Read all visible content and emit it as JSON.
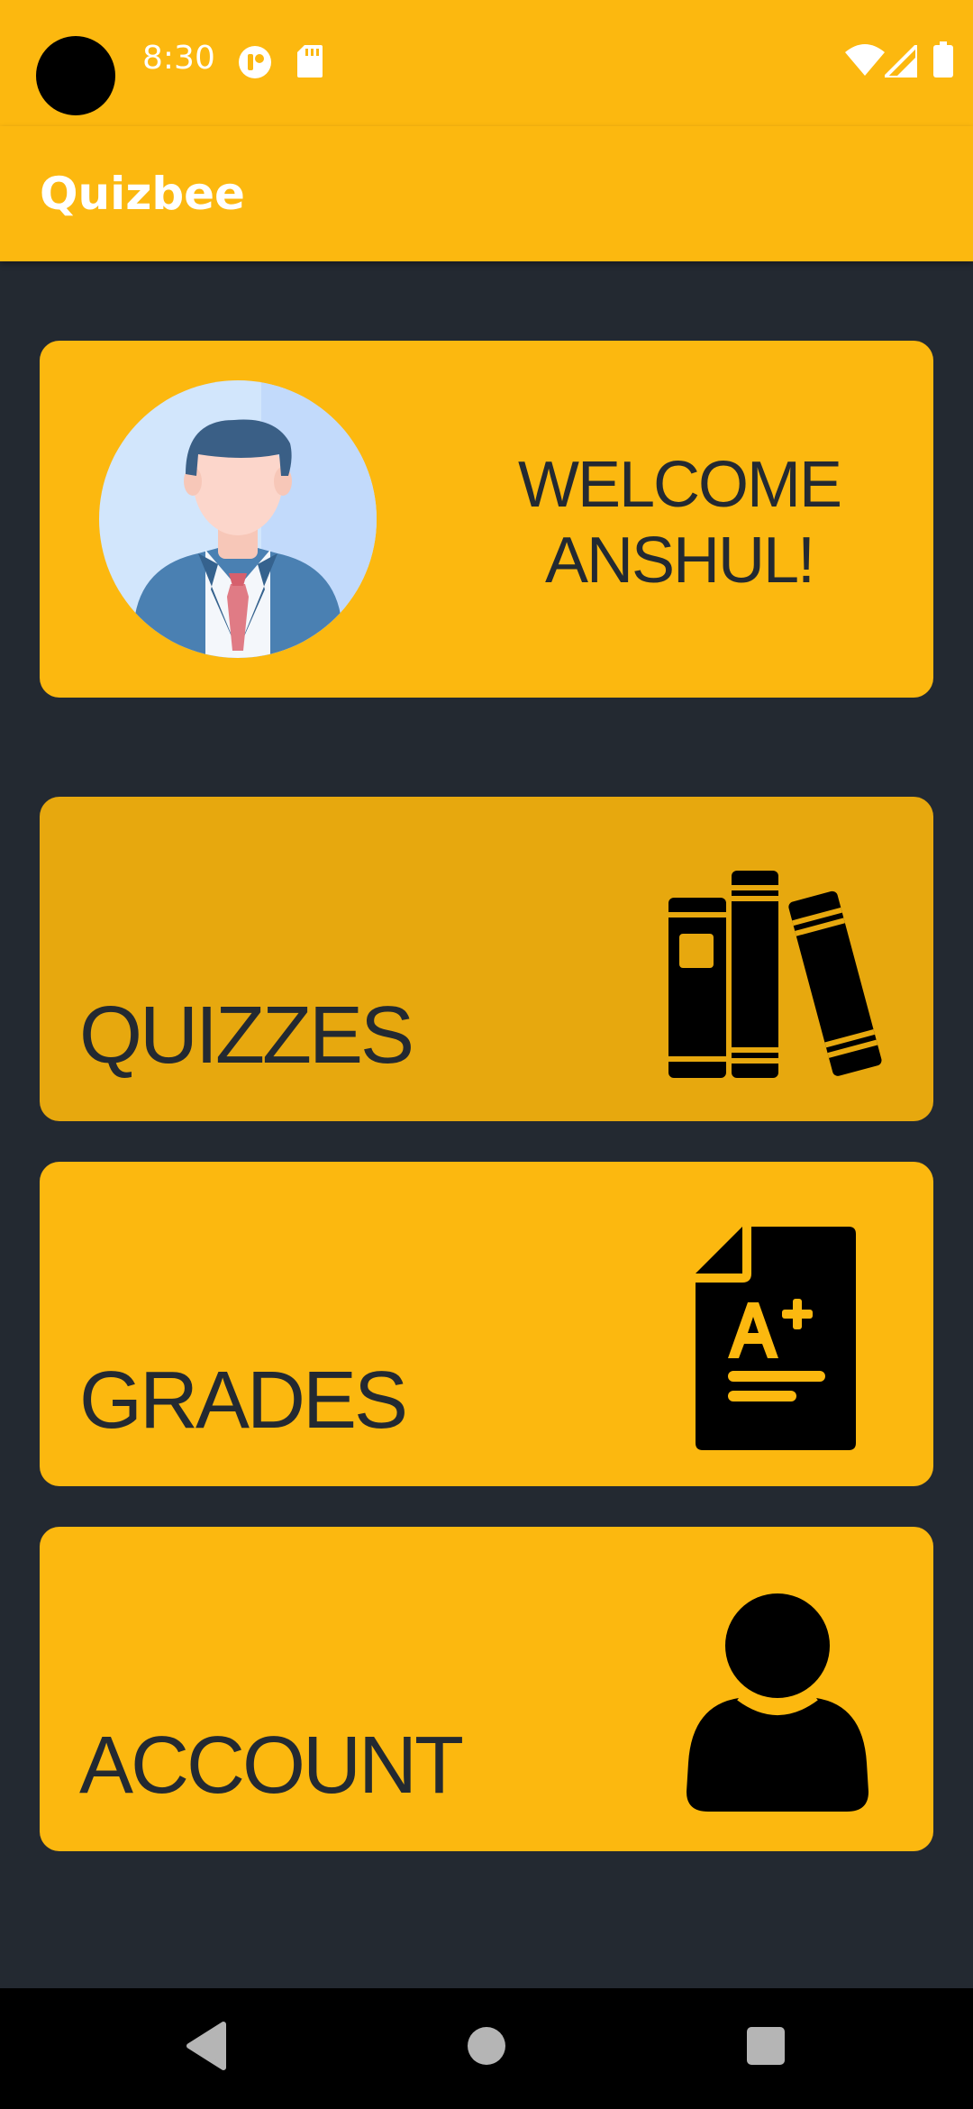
{
  "status_bar": {
    "time": "8:30",
    "icons": [
      "camera-dot",
      "app-notification-icon",
      "sd-card-icon",
      "wifi-icon",
      "signal-icon",
      "battery-icon"
    ]
  },
  "app_bar": {
    "title": "Quizbee"
  },
  "welcome": {
    "line1": "WELCOME",
    "line2": "ANSHUL!",
    "avatar_icon": "businessman-avatar-icon"
  },
  "menu": {
    "quizzes": {
      "label": "QUIZZES",
      "icon": "books-icon"
    },
    "grades": {
      "label": "GRADES",
      "icon": "grade-document-icon"
    },
    "account": {
      "label": "ACCOUNT",
      "icon": "person-icon"
    }
  },
  "nav_bar": {
    "icons": [
      "back-icon",
      "home-icon",
      "recents-icon"
    ]
  },
  "colors": {
    "accent": "#FCB80F",
    "accent_pressed": "#E7A80E",
    "background": "#232931",
    "text_dark": "#232931"
  }
}
